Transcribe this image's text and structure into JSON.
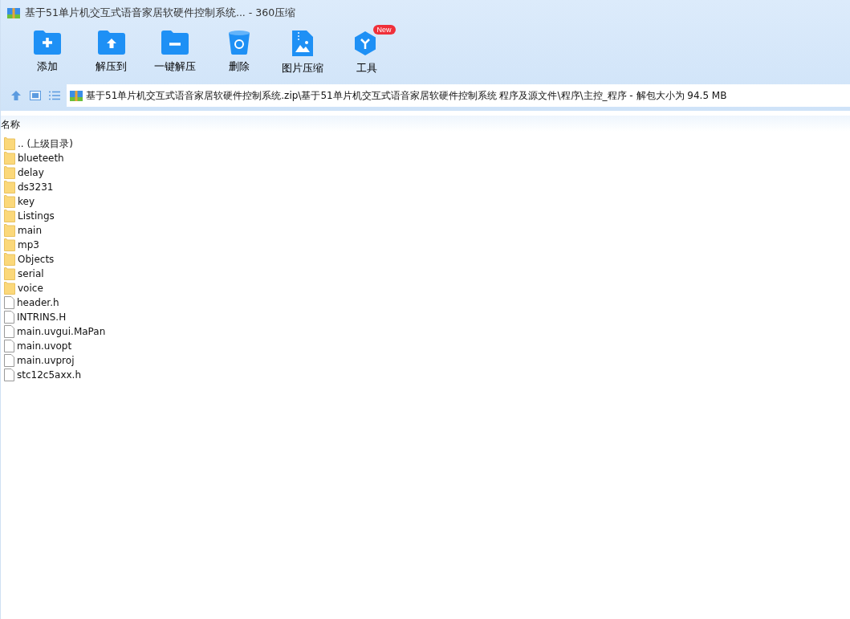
{
  "window": {
    "title": "基于51单片机交互式语音家居软硬件控制系统... - 360压缩"
  },
  "toolbar": [
    {
      "kind": "add",
      "label": "添加"
    },
    {
      "kind": "extract",
      "label": "解压到"
    },
    {
      "kind": "oneclick",
      "label": "一键解压"
    },
    {
      "kind": "delete",
      "label": "删除"
    },
    {
      "kind": "image",
      "label": "图片压缩"
    },
    {
      "kind": "tools",
      "label": "工具",
      "badge": "New"
    }
  ],
  "address": {
    "path": "基于51单片机交互式语音家居软硬件控制系统.zip\\基于51单片机交互式语音家居软硬件控制系统 程序及源文件\\程序\\主控_程序 - 解包大小为 94.5 MB"
  },
  "table": {
    "columns": [
      "名称"
    ],
    "rows": [
      {
        "kind": "folder",
        "name": ".. (上级目录)"
      },
      {
        "kind": "folder",
        "name": "blueteeth"
      },
      {
        "kind": "folder",
        "name": "delay"
      },
      {
        "kind": "folder",
        "name": "ds3231"
      },
      {
        "kind": "folder",
        "name": "key"
      },
      {
        "kind": "folder",
        "name": "Listings"
      },
      {
        "kind": "folder",
        "name": "main"
      },
      {
        "kind": "folder",
        "name": "mp3"
      },
      {
        "kind": "folder",
        "name": "Objects"
      },
      {
        "kind": "folder",
        "name": "serial"
      },
      {
        "kind": "folder",
        "name": "voice"
      },
      {
        "kind": "file",
        "name": "header.h"
      },
      {
        "kind": "file",
        "name": "INTRINS.H"
      },
      {
        "kind": "file",
        "name": "main.uvgui.MaPan"
      },
      {
        "kind": "file",
        "name": "main.uvopt"
      },
      {
        "kind": "file",
        "name": "main.uvproj"
      },
      {
        "kind": "file",
        "name": "stc12c5axx.h"
      }
    ]
  }
}
